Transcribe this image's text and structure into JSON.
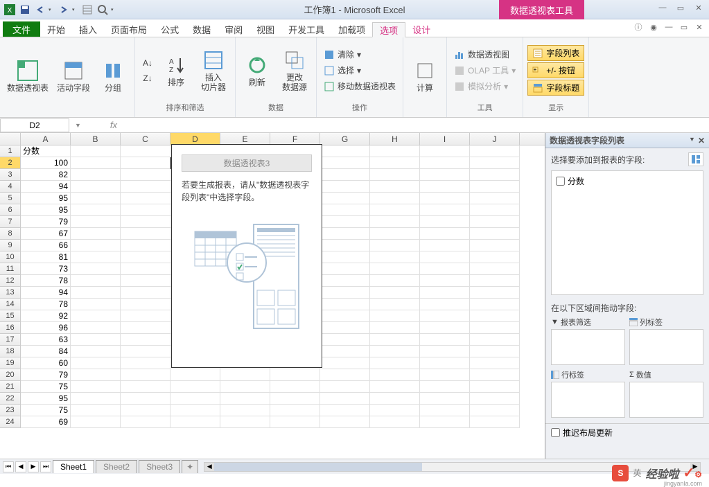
{
  "title": "工作簿1 - Microsoft Excel",
  "pivot_tool_title": "数据透视表工具",
  "tabs": {
    "file": "文件",
    "items": [
      "开始",
      "插入",
      "页面布局",
      "公式",
      "数据",
      "审阅",
      "视图",
      "开发工具",
      "加载项",
      "选项",
      "设计"
    ],
    "active_index": 9
  },
  "ribbon": {
    "groups": [
      {
        "label": "",
        "big": [
          {
            "label": "数据透视表"
          },
          {
            "label": "活动字段"
          },
          {
            "label": "分组"
          }
        ]
      },
      {
        "label": "排序和筛选",
        "big": [
          {
            "label": "排序"
          },
          {
            "label": "插入\n切片器"
          }
        ]
      },
      {
        "label": "数据",
        "big": [
          {
            "label": "刷新"
          },
          {
            "label": "更改\n数据源"
          }
        ]
      },
      {
        "label": "操作",
        "small": [
          {
            "label": "清除"
          },
          {
            "label": "选择"
          },
          {
            "label": "移动数据透视表"
          }
        ]
      },
      {
        "label": "",
        "big": [
          {
            "label": "计算"
          }
        ]
      },
      {
        "label": "工具",
        "small": [
          {
            "label": "数据透视图"
          },
          {
            "label": "OLAP 工具",
            "disabled": true
          },
          {
            "label": "模拟分析",
            "disabled": true
          }
        ]
      },
      {
        "label": "显示",
        "small_yellow": [
          {
            "label": "字段列表"
          },
          {
            "label": "+/- 按钮"
          },
          {
            "label": "字段标题"
          }
        ]
      }
    ]
  },
  "name_box": "D2",
  "columns": [
    "A",
    "B",
    "C",
    "D",
    "E",
    "F",
    "G",
    "H",
    "I",
    "J"
  ],
  "selected_col": "D",
  "selected_row": 2,
  "data_header": "分数",
  "data_values": [
    100,
    82,
    94,
    95,
    95,
    79,
    67,
    66,
    81,
    73,
    78,
    94,
    78,
    92,
    96,
    63,
    84,
    60,
    79,
    75,
    95,
    75,
    69
  ],
  "pivot_box": {
    "title": "数据透视表3",
    "text": "若要生成报表，请从\"数据透视表字段列表\"中选择字段。"
  },
  "task_pane": {
    "title": "数据透视表字段列表",
    "choose_label": "选择要添加到报表的字段:",
    "fields": [
      "分数"
    ],
    "drag_label": "在以下区域间拖动字段:",
    "areas": {
      "filter": "报表筛选",
      "columns": "列标签",
      "rows": "行标签",
      "values": "数值"
    },
    "defer_label": "推迟布局更新"
  },
  "sheets": [
    "Sheet1",
    "Sheet2",
    "Sheet3"
  ],
  "active_sheet": 0,
  "watermark": {
    "badge": "S",
    "small": "英",
    "text": "经验啦",
    "sub": "jingyanla.com"
  }
}
